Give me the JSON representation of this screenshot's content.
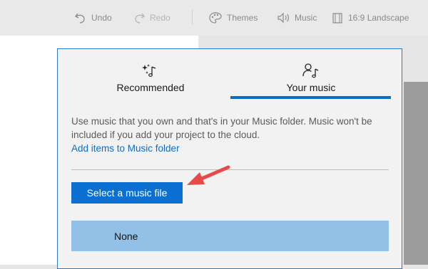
{
  "toolbar": {
    "undo_label": "Undo",
    "redo_label": "Redo",
    "themes_label": "Themes",
    "music_label": "Music",
    "aspect_label": "16:9 Landscape"
  },
  "tabs": [
    {
      "label": "Recommended",
      "icon": "music-sparkle-icon",
      "selected": false
    },
    {
      "label": "Your music",
      "icon": "person-music-icon",
      "selected": true
    }
  ],
  "content": {
    "description": "Use music that you own and that's in your Music folder. Music won't be included if you add your project to the cloud.",
    "link": "Add items to Music folder",
    "select_button": "Select a music file",
    "list_item": "None"
  },
  "colors": {
    "accent": "#0a6fd0",
    "selected_row": "#93c0e6",
    "annotation_arrow": "#e84a4a"
  }
}
